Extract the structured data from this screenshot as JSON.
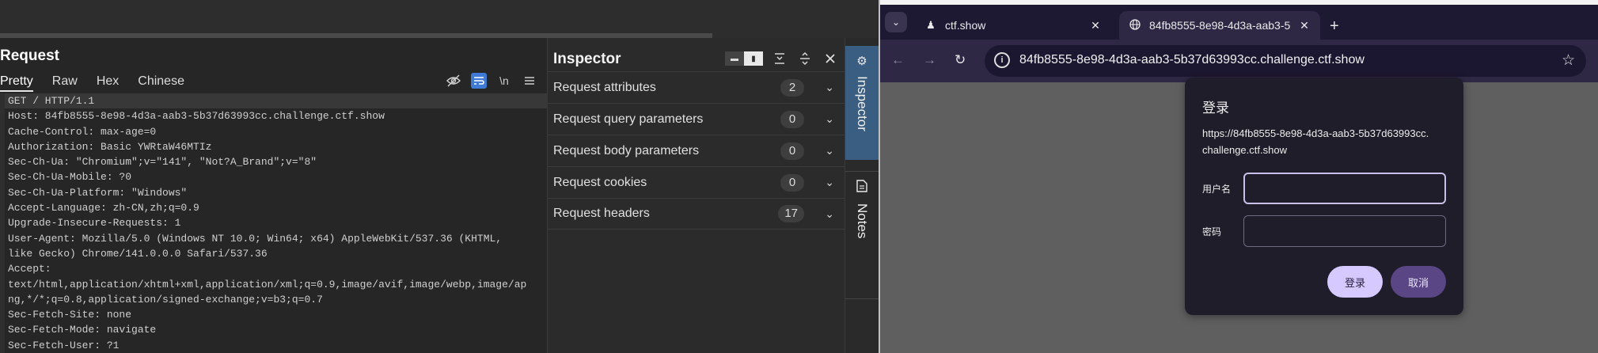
{
  "request": {
    "title": "Request",
    "tabs": [
      "Pretty",
      "Raw",
      "Hex",
      "Chinese"
    ],
    "active_tab": "Pretty",
    "tools": {
      "newline_label": "\\n"
    },
    "lines": [
      "GET / HTTP/1.1",
      "Host: 84fb8555-8e98-4d3a-aab3-5b37d63993cc.challenge.ctf.show",
      "Cache-Control: max-age=0",
      "Authorization: Basic YWRtaW46MTIz",
      "Sec-Ch-Ua: \"Chromium\";v=\"141\", \"Not?A_Brand\";v=\"8\"",
      "Sec-Ch-Ua-Mobile: ?0",
      "Sec-Ch-Ua-Platform: \"Windows\"",
      "Accept-Language: zh-CN,zh;q=0.9",
      "Upgrade-Insecure-Requests: 1",
      "User-Agent: Mozilla/5.0 (Windows NT 10.0; Win64; x64) AppleWebKit/537.36 (KHTML,",
      "like Gecko) Chrome/141.0.0.0 Safari/537.36",
      "Accept:",
      "text/html,application/xhtml+xml,application/xml;q=0.9,image/avif,image/webp,image/ap",
      "ng,*/*;q=0.8,application/signed-exchange;v=b3;q=0.7",
      "Sec-Fetch-Site: none",
      "Sec-Fetch-Mode: navigate",
      "Sec-Fetch-User: ?1"
    ]
  },
  "inspector": {
    "title": "Inspector",
    "rows": [
      {
        "label": "Request attributes",
        "count": "2"
      },
      {
        "label": "Request query parameters",
        "count": "0"
      },
      {
        "label": "Request body parameters",
        "count": "0"
      },
      {
        "label": "Request cookies",
        "count": "0"
      },
      {
        "label": "Request headers",
        "count": "17"
      }
    ]
  },
  "side_tabs": {
    "inspector": "Inspector",
    "notes": "Notes"
  },
  "browser": {
    "tabs": [
      {
        "title": "ctf.show"
      },
      {
        "title": "84fb8555-8e98-4d3a-aab3-5"
      }
    ],
    "url": "84fb8555-8e98-4d3a-aab3-5b37d63993cc.challenge.ctf.show",
    "dialog": {
      "title": "登录",
      "url_text": "https://84fb8555-8e98-4d3a-aab3-5b37d63993cc.challenge.ctf.show",
      "username_label": "用户名",
      "password_label": "密码",
      "username_value": "",
      "password_value": "",
      "login_label": "登录",
      "cancel_label": "取消"
    }
  }
}
